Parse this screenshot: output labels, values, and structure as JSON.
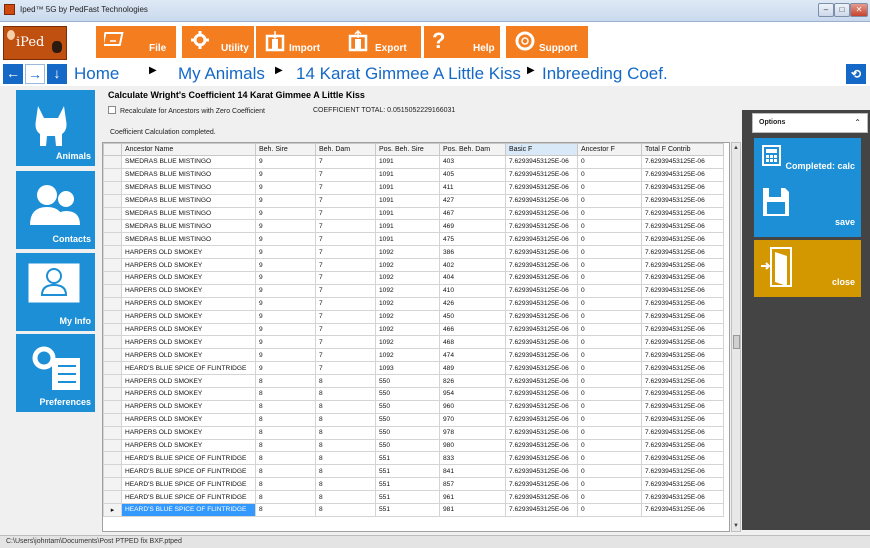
{
  "window": {
    "title": "Iped™ 5G by PedFast Technologies"
  },
  "logo": {
    "text": "iPed"
  },
  "toolbar": [
    {
      "label": "File",
      "icon": "file-icon"
    },
    {
      "label": "Utility",
      "icon": "gear-icon"
    },
    {
      "label": "Import",
      "icon": "import-icon"
    },
    {
      "label": "Export",
      "icon": "export-icon"
    },
    {
      "label": "Help",
      "icon": "help-icon"
    },
    {
      "label": "Support",
      "icon": "support-icon"
    }
  ],
  "breadcrumb": [
    "Home",
    "My Animals",
    "14 Karat Gimmee A Little Kiss",
    "Inbreeding Coef."
  ],
  "sidebar": [
    {
      "label": "Animals",
      "icon": "dog-icon"
    },
    {
      "label": "Contacts",
      "icon": "people-icon"
    },
    {
      "label": "My Info",
      "icon": "person-icon"
    },
    {
      "label": "Preferences",
      "icon": "settings-icon"
    }
  ],
  "main": {
    "heading": "Calculate Wright's Coefficient 14 Karat Gimmee A Little Kiss",
    "recalc_label": "Recalculate for Ancestors with Zero Coefficient",
    "coef_total": "COEFFICIENT TOTAL: 0.0515052229166031",
    "status_msg": "Coefficient Calculation completed."
  },
  "table": {
    "columns": [
      "Ancestor Name",
      "Beh. Sire",
      "Beh. Dam",
      "Pos. Beh. Sire",
      "Pos. Beh. Dam",
      "Basic F",
      "Ancestor F",
      "Total F Contrib"
    ],
    "sorted_column": "Basic F",
    "rows": [
      [
        "SMEDRAS BLUE MISTINGO",
        "9",
        "7",
        "1091",
        "403",
        "7.62939453125E-06",
        "0",
        "7.62939453125E-06"
      ],
      [
        "SMEDRAS BLUE MISTINGO",
        "9",
        "7",
        "1091",
        "405",
        "7.62939453125E-06",
        "0",
        "7.62939453125E-06"
      ],
      [
        "SMEDRAS BLUE MISTINGO",
        "9",
        "7",
        "1091",
        "411",
        "7.62939453125E-06",
        "0",
        "7.62939453125E-06"
      ],
      [
        "SMEDRAS BLUE MISTINGO",
        "9",
        "7",
        "1091",
        "427",
        "7.62939453125E-06",
        "0",
        "7.62939453125E-06"
      ],
      [
        "SMEDRAS BLUE MISTINGO",
        "9",
        "7",
        "1091",
        "467",
        "7.62939453125E-06",
        "0",
        "7.62939453125E-06"
      ],
      [
        "SMEDRAS BLUE MISTINGO",
        "9",
        "7",
        "1091",
        "469",
        "7.62939453125E-06",
        "0",
        "7.62939453125E-06"
      ],
      [
        "SMEDRAS BLUE MISTINGO",
        "9",
        "7",
        "1091",
        "475",
        "7.62939453125E-06",
        "0",
        "7.62939453125E-06"
      ],
      [
        "HARPERS OLD SMOKEY",
        "9",
        "7",
        "1092",
        "386",
        "7.62939453125E-06",
        "0",
        "7.62939453125E-06"
      ],
      [
        "HARPERS OLD SMOKEY",
        "9",
        "7",
        "1092",
        "402",
        "7.62939453125E-06",
        "0",
        "7.62939453125E-06"
      ],
      [
        "HARPERS OLD SMOKEY",
        "9",
        "7",
        "1092",
        "404",
        "7.62939453125E-06",
        "0",
        "7.62939453125E-06"
      ],
      [
        "HARPERS OLD SMOKEY",
        "9",
        "7",
        "1092",
        "410",
        "7.62939453125E-06",
        "0",
        "7.62939453125E-06"
      ],
      [
        "HARPERS OLD SMOKEY",
        "9",
        "7",
        "1092",
        "426",
        "7.62939453125E-06",
        "0",
        "7.62939453125E-06"
      ],
      [
        "HARPERS OLD SMOKEY",
        "9",
        "7",
        "1092",
        "450",
        "7.62939453125E-06",
        "0",
        "7.62939453125E-06"
      ],
      [
        "HARPERS OLD SMOKEY",
        "9",
        "7",
        "1092",
        "466",
        "7.62939453125E-06",
        "0",
        "7.62939453125E-06"
      ],
      [
        "HARPERS OLD SMOKEY",
        "9",
        "7",
        "1092",
        "468",
        "7.62939453125E-06",
        "0",
        "7.62939453125E-06"
      ],
      [
        "HARPERS OLD SMOKEY",
        "9",
        "7",
        "1092",
        "474",
        "7.62939453125E-06",
        "0",
        "7.62939453125E-06"
      ],
      [
        "HEARD'S BLUE SPICE OF FLINTRIDGE",
        "9",
        "7",
        "1093",
        "489",
        "7.62939453125E-06",
        "0",
        "7.62939453125E-06"
      ],
      [
        "HARPERS OLD SMOKEY",
        "8",
        "8",
        "550",
        "826",
        "7.62939453125E-06",
        "0",
        "7.62939453125E-06"
      ],
      [
        "HARPERS OLD SMOKEY",
        "8",
        "8",
        "550",
        "954",
        "7.62939453125E-06",
        "0",
        "7.62939453125E-06"
      ],
      [
        "HARPERS OLD SMOKEY",
        "8",
        "8",
        "550",
        "960",
        "7.62939453125E-06",
        "0",
        "7.62939453125E-06"
      ],
      [
        "HARPERS OLD SMOKEY",
        "8",
        "8",
        "550",
        "970",
        "7.62939453125E-06",
        "0",
        "7.62939453125E-06"
      ],
      [
        "HARPERS OLD SMOKEY",
        "8",
        "8",
        "550",
        "978",
        "7.62939453125E-06",
        "0",
        "7.62939453125E-06"
      ],
      [
        "HARPERS OLD SMOKEY",
        "8",
        "8",
        "550",
        "980",
        "7.62939453125E-06",
        "0",
        "7.62939453125E-06"
      ],
      [
        "HEARD'S BLUE SPICE OF FLINTRIDGE",
        "8",
        "8",
        "551",
        "833",
        "7.62939453125E-06",
        "0",
        "7.62939453125E-06"
      ],
      [
        "HEARD'S BLUE SPICE OF FLINTRIDGE",
        "8",
        "8",
        "551",
        "841",
        "7.62939453125E-06",
        "0",
        "7.62939453125E-06"
      ],
      [
        "HEARD'S BLUE SPICE OF FLINTRIDGE",
        "8",
        "8",
        "551",
        "857",
        "7.62939453125E-06",
        "0",
        "7.62939453125E-06"
      ],
      [
        "HEARD'S BLUE SPICE OF FLINTRIDGE",
        "8",
        "8",
        "551",
        "961",
        "7.62939453125E-06",
        "0",
        "7.62939453125E-06"
      ],
      [
        "HEARD'S BLUE SPICE OF FLINTRIDGE",
        "8",
        "8",
        "551",
        "981",
        "7.62939453125E-06",
        "0",
        "7.62939453125E-06"
      ]
    ],
    "selected_row": 27
  },
  "options": {
    "title": "Options",
    "items": [
      {
        "label": "Completed: calc",
        "icon": "calculator-icon",
        "color": "#1d8fd6"
      },
      {
        "label": "save",
        "icon": "floppy-disk-icon",
        "color": "#1d8fd6"
      },
      {
        "label": "close",
        "icon": "door-exit-icon",
        "color": "#d39700"
      }
    ]
  },
  "statusbar": {
    "path": "C:\\Users\\johntam\\Documents\\Post PTPED fix BXF.ptped"
  },
  "colors": {
    "accent_orange": "#f47d20",
    "accent_blue": "#1469c7",
    "tile_blue": "#1d8fd6",
    "close_gold": "#d39700"
  }
}
